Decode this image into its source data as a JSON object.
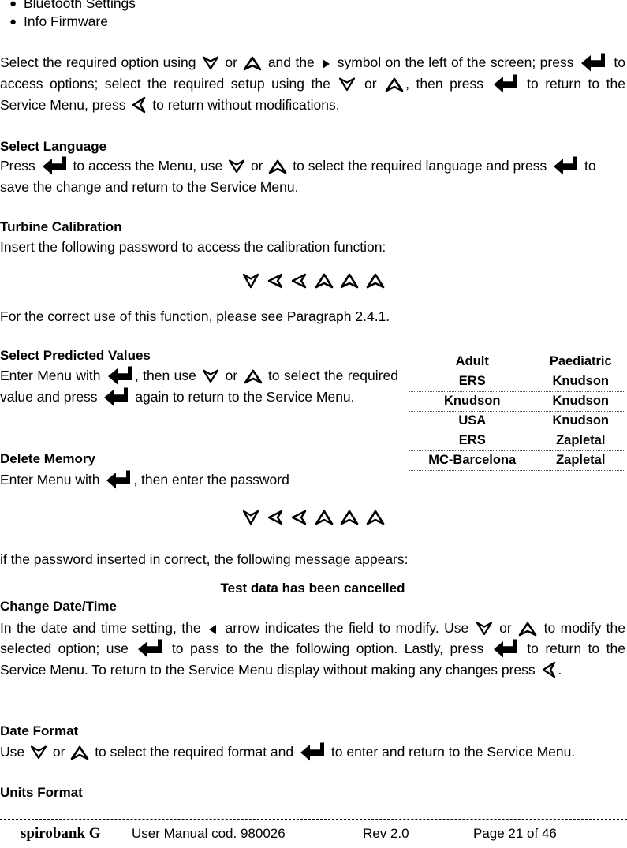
{
  "bullet_list": {
    "items": [
      {
        "label": "Bluetooth Settings"
      },
      {
        "label": "Info Firmware"
      }
    ]
  },
  "intro_paragraph": {
    "p1": "Select the required option using",
    "p2": "or",
    "p3": "and the",
    "p4": "symbol on the left of the screen; press",
    "p5": "to access options; select the required setup using the",
    "p6": "or",
    "p7": ", then press",
    "p8": "to return to the Service Menu, press",
    "p9": "to return without modifications."
  },
  "select_language": {
    "heading": "Select Language",
    "p1": "Press",
    "p2": "to access the Menu, use",
    "p3": "or",
    "p4": "to select the required language and press",
    "p5": "to save the change and return to the Service Menu."
  },
  "turbine_calibration": {
    "heading": "Turbine Calibration",
    "p1": "Insert the following password to access the calibration function:",
    "password_sequence": [
      "down",
      "left",
      "left",
      "up",
      "up",
      "up"
    ],
    "p2": "For the correct use of this function, please see Paragraph 2.4.1."
  },
  "select_predicted_values": {
    "heading": "Select Predicted Values",
    "p1": "Enter Menu with",
    "p2": ", then use",
    "p3": "or",
    "p4": "to select the required value and press",
    "p5": "again to return to the Service Menu."
  },
  "predicted_table": {
    "columns": [
      "Adult",
      "Paediatric"
    ],
    "rows": [
      [
        "ERS",
        "Knudson"
      ],
      [
        "Knudson",
        "Knudson"
      ],
      [
        "USA",
        "Knudson"
      ],
      [
        "ERS",
        "Zapletal"
      ],
      [
        "MC-Barcelona",
        "Zapletal"
      ]
    ]
  },
  "delete_memory": {
    "heading": "Delete Memory",
    "p1": "Enter Menu with",
    "p2": ", then enter the password",
    "password_sequence": [
      "down",
      "left",
      "left",
      "up",
      "up",
      "up"
    ],
    "p3": "if the password inserted in correct, the following message appears:",
    "message": "Test data has been cancelled"
  },
  "change_date_time": {
    "heading": "Change Date/Time",
    "p1": "In the date and time setting, the",
    "p2": "arrow indicates the field to modify. Use",
    "p3": "or",
    "p4": "to modify the selected option; use",
    "p5": "to pass to the the following option. Lastly, press",
    "p6": "to return to the Service Menu. To return to the Service Menu display without making any changes press",
    "p7": "."
  },
  "date_format": {
    "heading": "Date Format",
    "p1": "Use",
    "p2": "or",
    "p3": "to select the required format and",
    "p4": "to enter and return to the Service Menu."
  },
  "units_format": {
    "heading": "Units Format"
  },
  "footer": {
    "brand": "spirobank G",
    "manual_code": "User Manual cod. 980026",
    "revision": "Rev 2.0",
    "page": "Page 21 of 46"
  },
  "icons": {
    "down_arrow": "down-arrow-icon",
    "up_arrow": "up-arrow-icon",
    "left_arrow": "left-arrow-icon",
    "right_triangle": "right-triangle-icon",
    "left_triangle": "left-triangle-icon",
    "enter_arrow": "enter-arrow-icon"
  },
  "colors": {
    "text": "#000000",
    "background": "#ffffff",
    "rule": "#555555"
  }
}
